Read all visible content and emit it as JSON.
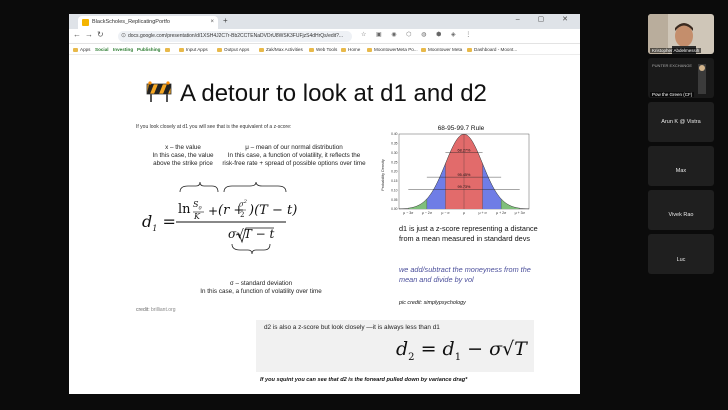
{
  "browser": {
    "tab_title": "BlackScholes_ReplicatingPortfo",
    "new_tab": "+",
    "url": "docs.google.com/presentation/d/1XSH4J2C7r-Bb2CCTENaDVDrU8WSK3FUFjzS4dHrQs/edit?...",
    "window_controls": "– ▢ ✕",
    "bookmarks": [
      {
        "label": "Apps"
      },
      {
        "label": "Social"
      },
      {
        "label": "Investing"
      },
      {
        "label": "Publishing"
      },
      {
        "label": "Input Apps"
      },
      {
        "label": "Output Apps"
      },
      {
        "label": "Zak/Max Activities"
      },
      {
        "label": "Web Tools"
      },
      {
        "label": "Home"
      },
      {
        "label": "MoontowerMeta Po..."
      },
      {
        "label": "Moontower Meta"
      },
      {
        "label": "Dashboard - Moont..."
      }
    ]
  },
  "slide": {
    "title": "A detour to look at d1 and d2",
    "caption_top": "If you look closely at d1 you will see that is the equivalent of a z-score:",
    "annotations": {
      "x_label": "x – the value",
      "x_desc_1": "In this case, the value",
      "x_desc_2": "above the strike price",
      "mu_label": "μ – mean of our normal distribution",
      "mu_desc_1": "In this case, a function of volatility, it reflects the",
      "mu_desc_2": "risk-free rate + spread of possible options over time",
      "sigma_label": "σ – standard deviation",
      "sigma_desc": "In this case, a function of volatility over time"
    },
    "formula": {
      "d1": "d",
      "d1_sub": "1",
      "eq": "=",
      "ln": "ln",
      "S0": "S",
      "S0_sub": "0",
      "K": "K",
      "plus": "+",
      "r": "(r +",
      "sigma2": "σ",
      "two": "2",
      "time": ")(T − t)",
      "den": "σ√T − t"
    },
    "credit_label": "credit:",
    "credit_link": "brilliant.org",
    "chart_title": "68-95-99.7 Rule",
    "chart_ylabel": "Probability Density",
    "chart_yticks": [
      "0.40",
      "0.35",
      "0.30",
      "0.25",
      "0.20",
      "0.15",
      "0.10",
      "0.05",
      "0.00"
    ],
    "chart_xticks": [
      "μ − 3σ",
      "μ − 2σ",
      "μ − σ",
      "μ",
      "μ + σ",
      "μ + 2σ",
      "μ + 3σ"
    ],
    "chart_pcts": [
      "68.27%",
      "95.45%",
      "99.73%"
    ],
    "text1": "d1 is just a z-score representing a distance from a mean measured in standard devs",
    "text2": "we add/subtract the moneyness from the mean and divide by vol",
    "pic_credit": "pic credit: simplypsychology",
    "d2_label": "d2 is also a z-score but look closely —it is always less than d1",
    "d2_eq": {
      "lhs": "d",
      "lhs_sub": "2",
      "mid": "= d",
      "mid_sub": "1",
      "rest": "− σ√T"
    },
    "bottom_line": "If you squint you can see that d2 is the forward pulled down by variance drag*"
  },
  "participants": [
    {
      "name": "Kristopher Abdelmessih"
    },
    {
      "name": "Pow the Green (CF)"
    },
    {
      "name": "Arun K @ Vistra"
    },
    {
      "name": "Max"
    },
    {
      "name": "Vivek Rao"
    },
    {
      "name": "Luc"
    }
  ],
  "colors": {
    "accent_red": "#e26b6b",
    "accent_blue": "#6f7de6",
    "accent_green": "#7fbf7b",
    "italic_purple": "#4b4f9b"
  }
}
